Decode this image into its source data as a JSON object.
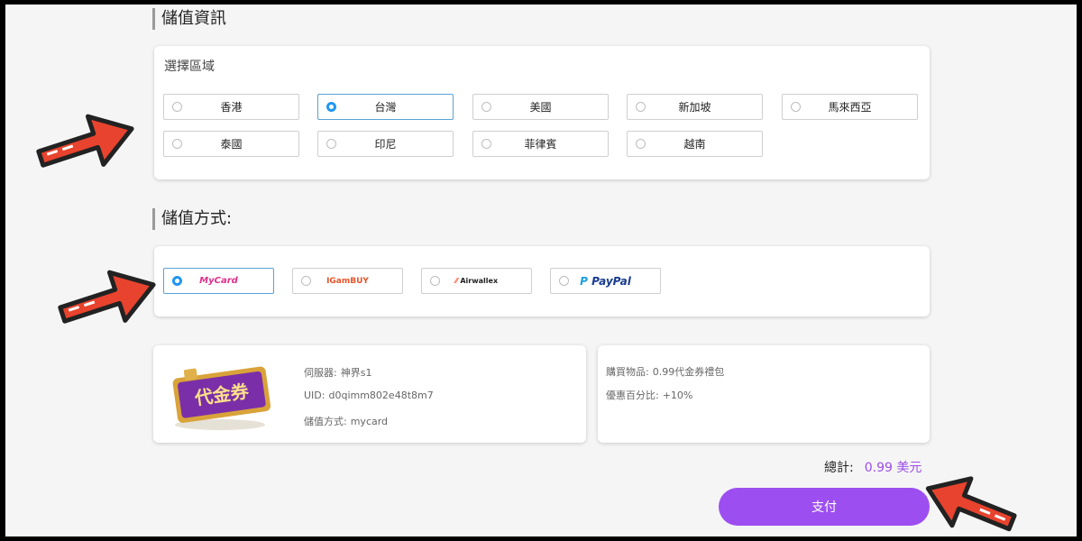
{
  "section_info_title": "儲值資訊",
  "region": {
    "label": "選擇區域",
    "options": [
      "香港",
      "台灣",
      "美國",
      "新加坡",
      "馬來西亞",
      "泰國",
      "印尼",
      "菲律賓",
      "越南"
    ],
    "selected": "台灣"
  },
  "section_method_title": "儲值方式:",
  "payment": {
    "options": [
      "MyCard",
      "IGamBUY",
      "Airwallex",
      "PayPal"
    ],
    "selected": "MyCard"
  },
  "product_image_text": "代金券",
  "order_left": {
    "server_label": "伺服器:",
    "server_value": "神界s1",
    "uid_label": "UID:",
    "uid_value": "d0qimm802e48t8m7",
    "method_label": "儲值方式:",
    "method_value": "mycard"
  },
  "order_right": {
    "item_label": "購買物品:",
    "item_value": "0.99代金券禮包",
    "bonus_label": "優惠百分比:",
    "bonus_value": "+10%"
  },
  "total": {
    "label": "總計:",
    "amount": "0.99 美元"
  },
  "pay_button": "支付",
  "colors": {
    "accent": "#9d4ef0",
    "radio_selected": "#2196f3",
    "arrow": "#e8432e"
  }
}
